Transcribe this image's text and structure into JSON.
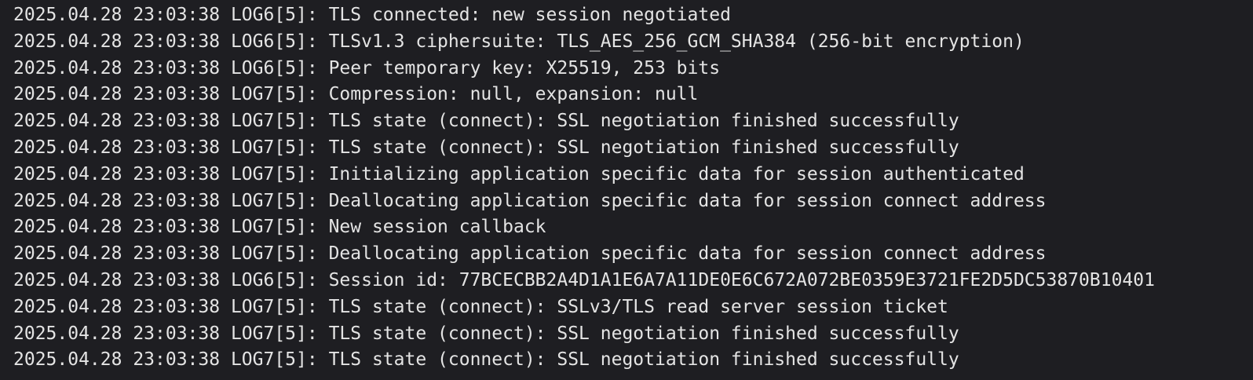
{
  "terminal": {
    "lines": [
      "2025.04.28 23:03:38 LOG6[5]: TLS connected: new session negotiated",
      "2025.04.28 23:03:38 LOG6[5]: TLSv1.3 ciphersuite: TLS_AES_256_GCM_SHA384 (256-bit encryption)",
      "2025.04.28 23:03:38 LOG6[5]: Peer temporary key: X25519, 253 bits",
      "2025.04.28 23:03:38 LOG7[5]: Compression: null, expansion: null",
      "2025.04.28 23:03:38 LOG7[5]: TLS state (connect): SSL negotiation finished successfully",
      "2025.04.28 23:03:38 LOG7[5]: TLS state (connect): SSL negotiation finished successfully",
      "2025.04.28 23:03:38 LOG7[5]: Initializing application specific data for session authenticated",
      "2025.04.28 23:03:38 LOG7[5]: Deallocating application specific data for session connect address",
      "2025.04.28 23:03:38 LOG7[5]: New session callback",
      "2025.04.28 23:03:38 LOG7[5]: Deallocating application specific data for session connect address",
      "2025.04.28 23:03:38 LOG6[5]: Session id: 77BCECBB2A4D1A1E6A7A11DE0E6C672A072BE0359E3721FE2D5DC53870B10401",
      "2025.04.28 23:03:38 LOG7[5]: TLS state (connect): SSLv3/TLS read server session ticket",
      "2025.04.28 23:03:38 LOG7[5]: TLS state (connect): SSL negotiation finished successfully",
      "2025.04.28 23:03:38 LOG7[5]: TLS state (connect): SSL negotiation finished successfully"
    ]
  },
  "colors": {
    "background": "#1e1e22",
    "text": "#e4e4e4"
  }
}
